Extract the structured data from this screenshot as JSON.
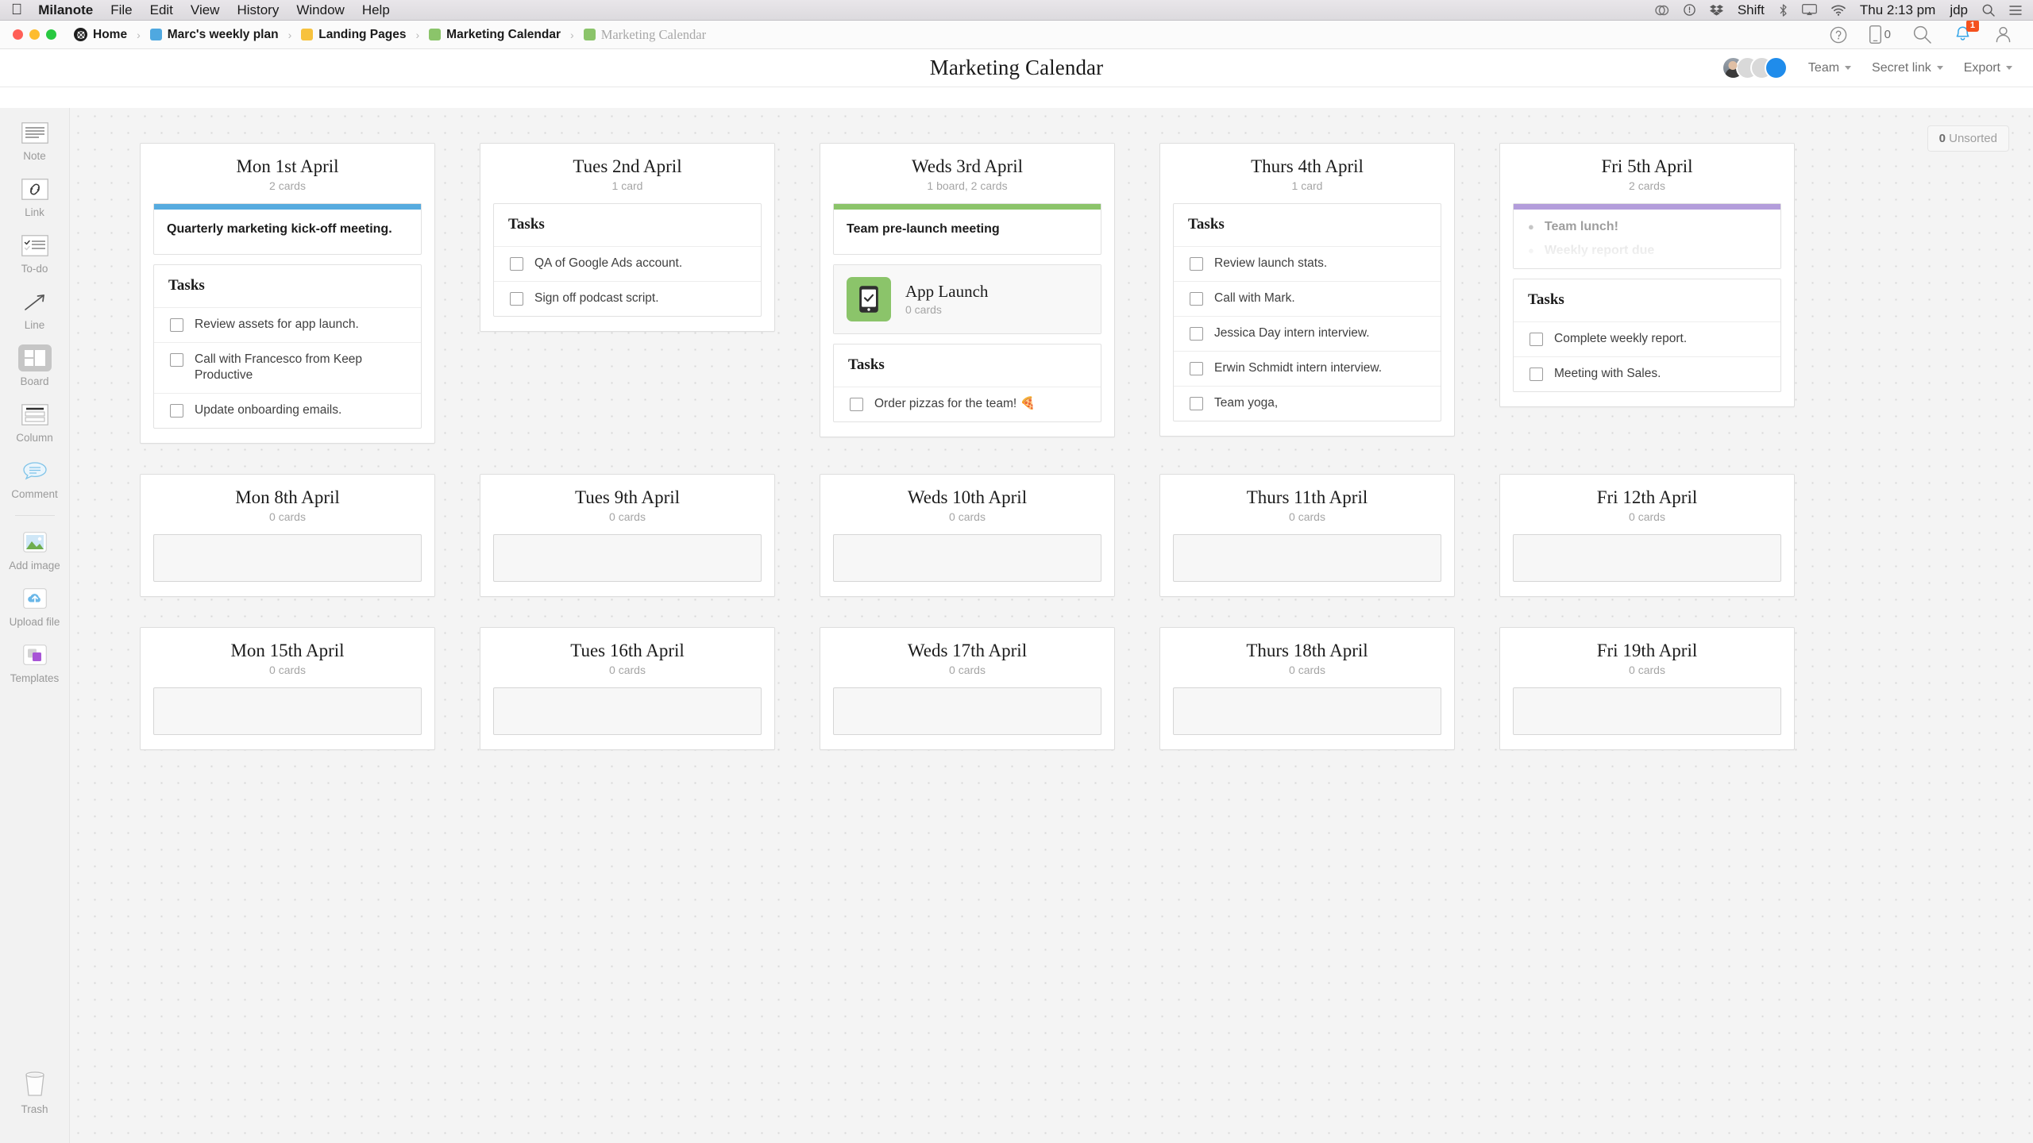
{
  "menubar": {
    "apple": "apple-logo",
    "items": [
      "Milanote",
      "File",
      "Edit",
      "View",
      "History",
      "Window",
      "Help"
    ],
    "app_name": "Milanote",
    "right": {
      "shift_label": "Shift",
      "clock": "Thu 2:13 pm",
      "user": "jdp",
      "icons": [
        "creative-cloud-icon",
        "dropbox-icon",
        "bluetooth-icon",
        "airplay-icon",
        "wifi-icon",
        "spotlight-search-icon",
        "control-center-icon"
      ]
    }
  },
  "topbar": {
    "breadcrumb": [
      {
        "label": "Home",
        "chip": "home-icon",
        "color": "#1d1d1d",
        "dim": false
      },
      {
        "label": "Marc's weekly plan",
        "chip": "square",
        "color": "#4fa8e0",
        "dim": false
      },
      {
        "label": "Landing Pages",
        "chip": "square",
        "color": "#f7c23e",
        "dim": false
      },
      {
        "label": "Marketing Calendar",
        "chip": "square",
        "color": "#8bc46a",
        "dim": false
      },
      {
        "label": "Marketing Calendar",
        "chip": "square",
        "color": "#8bc46a",
        "dim": true
      }
    ],
    "separator": "›",
    "help_icon": "help-circle-icon",
    "mobile_icon": "mobile-phone-icon",
    "mobile_count": "0",
    "search_icon": "search-icon",
    "bell_icon": "bell-icon",
    "bell_badge": "1",
    "account_icon": "user-account-icon"
  },
  "header": {
    "title": "Marketing Calendar",
    "team_label": "Team",
    "secret_link_label": "Secret link",
    "export_label": "Export",
    "avatar_count": 3
  },
  "rail": {
    "tools": [
      {
        "label": "Note",
        "icon": "note-icon"
      },
      {
        "label": "Link",
        "icon": "link-icon"
      },
      {
        "label": "To-do",
        "icon": "todo-icon"
      },
      {
        "label": "Line",
        "icon": "line-arrow-icon"
      },
      {
        "label": "Board",
        "icon": "board-icon"
      },
      {
        "label": "Column",
        "icon": "column-icon"
      },
      {
        "label": "Comment",
        "icon": "comment-icon"
      }
    ],
    "tools2": [
      {
        "label": "Add image",
        "icon": "add-image-icon"
      },
      {
        "label": "Upload file",
        "icon": "upload-file-icon"
      },
      {
        "label": "Templates",
        "icon": "templates-icon"
      }
    ],
    "trash": {
      "label": "Trash",
      "icon": "trash-icon"
    }
  },
  "canvas": {
    "unsorted_count": "0",
    "unsorted_label": "Unsorted",
    "tasks_header": "Tasks",
    "columns": [
      {
        "title": "Mon 1st April",
        "subtitle": "2 cards",
        "cards": [
          {
            "type": "note",
            "accent": "#56abdf",
            "text": "Quarterly marketing kick-off meeting."
          },
          {
            "type": "tasks",
            "header": "Tasks",
            "items": [
              "Review assets for app launch.",
              "Call with Francesco from Keep Productive",
              "Update onboarding emails."
            ]
          }
        ]
      },
      {
        "title": "Tues 2nd April",
        "subtitle": "1 card",
        "cards": [
          {
            "type": "tasks",
            "header": "Tasks",
            "items": [
              "QA of Google Ads account.",
              "Sign off podcast script."
            ]
          }
        ]
      },
      {
        "title": "Weds 3rd April",
        "subtitle": "1 board, 2 cards",
        "cards": [
          {
            "type": "note",
            "accent": "#8bc46a",
            "text": "Team pre-launch meeting"
          },
          {
            "type": "board",
            "name": "App Launch",
            "sub": "0 cards",
            "icon": "mobile-check-icon",
            "color": "#8bc46a"
          },
          {
            "type": "tasks",
            "header": "Tasks",
            "items": [
              "Order pizzas for the team! 🍕"
            ]
          }
        ]
      },
      {
        "title": "Thurs 4th April",
        "subtitle": "1 card",
        "cards": [
          {
            "type": "tasks",
            "header": "Tasks",
            "items": [
              "Review launch stats.",
              "Call with Mark.",
              "Jessica Day intern interview.",
              "Erwin Schmidt intern interview.",
              "Team yoga,"
            ]
          }
        ]
      },
      {
        "title": "Fri 5th April",
        "subtitle": "2 cards",
        "cards": [
          {
            "type": "bullets",
            "accent": "#b39ddb",
            "items": [
              "Team lunch!",
              "Weekly report due"
            ]
          },
          {
            "type": "tasks",
            "header": "Tasks",
            "items": [
              "Complete weekly report.",
              "Meeting with Sales."
            ]
          }
        ]
      },
      {
        "title": "Mon 8th April",
        "subtitle": "0 cards",
        "cards": [
          {
            "type": "empty"
          }
        ]
      },
      {
        "title": "Tues 9th April",
        "subtitle": "0 cards",
        "cards": [
          {
            "type": "empty"
          }
        ]
      },
      {
        "title": "Weds 10th April",
        "subtitle": "0 cards",
        "cards": [
          {
            "type": "empty"
          }
        ]
      },
      {
        "title": "Thurs 11th April",
        "subtitle": "0 cards",
        "cards": [
          {
            "type": "empty"
          }
        ]
      },
      {
        "title": "Fri 12th April",
        "subtitle": "0 cards",
        "cards": [
          {
            "type": "empty"
          }
        ]
      },
      {
        "title": "Mon 15th April",
        "subtitle": "0 cards",
        "cards": [
          {
            "type": "empty"
          }
        ]
      },
      {
        "title": "Tues 16th April",
        "subtitle": "0 cards",
        "cards": [
          {
            "type": "empty"
          }
        ]
      },
      {
        "title": "Weds 17th April",
        "subtitle": "0 cards",
        "cards": [
          {
            "type": "empty"
          }
        ]
      },
      {
        "title": "Thurs 18th April",
        "subtitle": "0 cards",
        "cards": [
          {
            "type": "empty"
          }
        ]
      },
      {
        "title": "Fri 19th April",
        "subtitle": "0 cards",
        "cards": [
          {
            "type": "empty"
          }
        ]
      }
    ]
  }
}
